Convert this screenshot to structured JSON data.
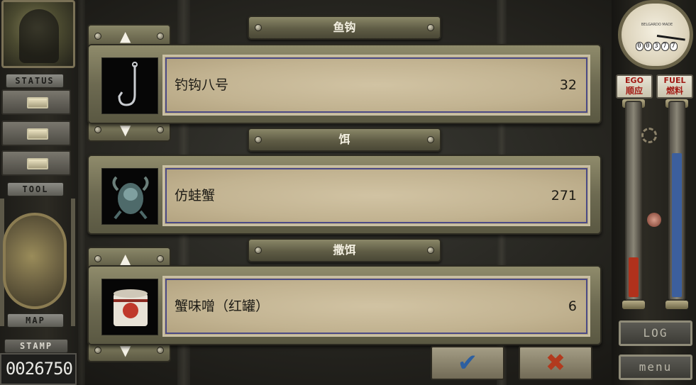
{
  "left_panel": {
    "status_label": "STATUS",
    "tool_label": "TOOL",
    "map_label": "MAP",
    "stamp_label": "STAMP",
    "stamp_value": "0026750"
  },
  "right_panel": {
    "gauge_caption": "BELGARDO MADE",
    "odometer_digits": [
      "0",
      "0",
      "3",
      "7",
      "7"
    ],
    "ego_label_en": "EGO",
    "ego_label_cn": "顺应",
    "fuel_label_en": "FUEL",
    "fuel_label_cn": "燃料",
    "ego_level": 0.2,
    "fuel_level": 0.73,
    "ego_color": "#b0311c",
    "fuel_color": "#3c5f9d",
    "log_label": "LOG",
    "menu_label": "menu"
  },
  "sections": [
    {
      "header": "鱼钩",
      "has_up_arrow": true,
      "has_down_arrow": true,
      "item": {
        "name": "钓钩八号",
        "qty": "32",
        "icon": "fish-hook-icon"
      }
    },
    {
      "header": "饵",
      "has_up_arrow": false,
      "has_down_arrow": false,
      "item": {
        "name": "仿蛙蟹",
        "qty": "271",
        "icon": "frog-crab-lure-icon"
      }
    },
    {
      "header": "撒饵",
      "has_up_arrow": true,
      "has_down_arrow": true,
      "item": {
        "name": "蟹味噌（红罐）",
        "qty": "6",
        "icon": "tin-can-icon"
      }
    }
  ],
  "arrows": {
    "up": "▲",
    "down": "▼"
  },
  "actions": {
    "confirm": "✔",
    "cancel": "✖"
  },
  "colors": {
    "confirm": "#2d5fa0",
    "cancel": "#b23a1e",
    "row_outline": "#4b4b86"
  }
}
